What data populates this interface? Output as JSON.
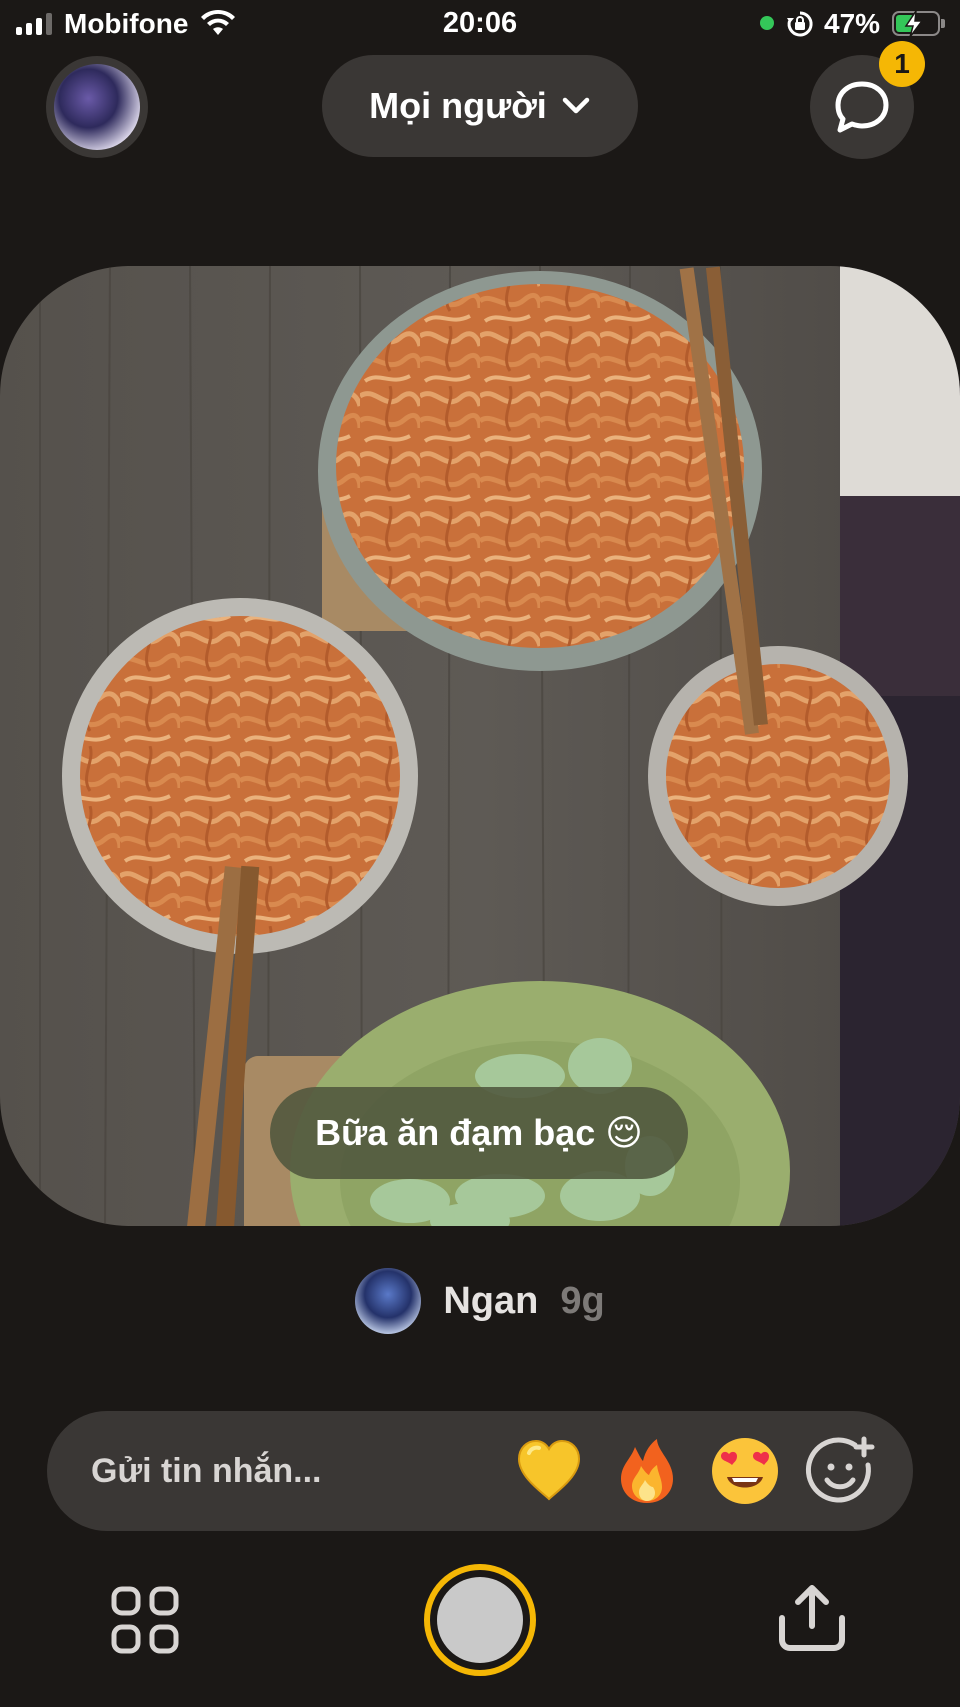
{
  "status_bar": {
    "carrier": "Mobifone",
    "time": "20:06",
    "battery_percent": "47%",
    "battery_level": 0.47,
    "icons": [
      "signal-icon",
      "wifi-icon",
      "camera-in-use-dot",
      "rotation-lock-icon",
      "battery-charging-icon"
    ]
  },
  "header": {
    "audience_label": "Mọi người",
    "audience_icon": "chevron-down-icon",
    "chat_icon": "chat-bubble-icon",
    "chat_badge": "1",
    "badge_color": "#f5b705"
  },
  "post": {
    "caption": "Bữa ăn đạm bạc 😌",
    "author_name": "Ngan",
    "time_ago": "9g"
  },
  "composer": {
    "placeholder": "Gửi tin nhắn...",
    "reactions": [
      "💛",
      "🔥",
      "😍"
    ],
    "add_reaction_icon": "smiley-plus-icon"
  },
  "bottom_bar": {
    "left_icon": "grid-icon",
    "center": "shutter-button",
    "right_icon": "share-icon",
    "accent_color": "#f5b705"
  },
  "colors": {
    "background": "#1b1816",
    "surface": "#3a3735"
  }
}
